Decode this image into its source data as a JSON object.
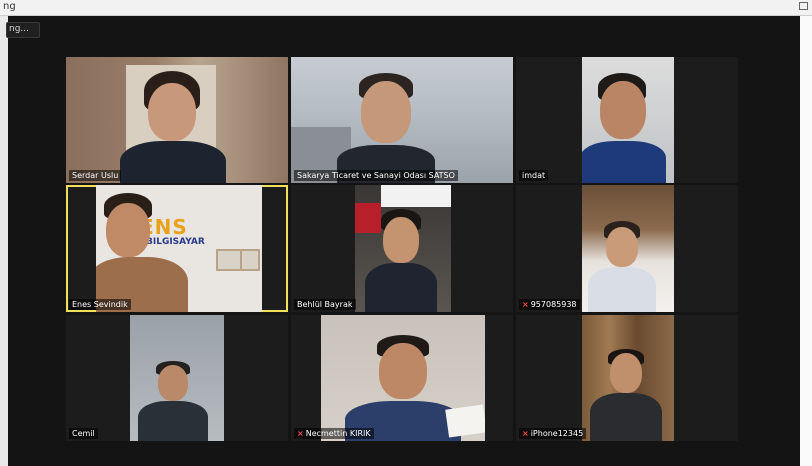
{
  "window": {
    "title": "ng",
    "status_pill": "ng..."
  },
  "participants": [
    {
      "name": "Serdar Uslu",
      "muted": false
    },
    {
      "name": "Sakarya Ticaret ve Sanayi Odası SATSO",
      "muted": false
    },
    {
      "name": "imdat",
      "muted": false
    },
    {
      "name": "Enes Sevindik",
      "muted": false,
      "active_speaker": true
    },
    {
      "name": "Behlül Bayrak",
      "muted": false
    },
    {
      "name": "957085938",
      "muted": true
    },
    {
      "name": "Cemil",
      "muted": false
    },
    {
      "name": "Necmettin KIRIK",
      "muted": true
    },
    {
      "name": "iPhone12345",
      "muted": true
    }
  ],
  "banner": {
    "line1": "ENS",
    "line2": "BILGISAYAR"
  },
  "colors": {
    "active_border": "#f3e05a",
    "mute_icon": "#ff4b4b",
    "meeting_bg": "#141414"
  },
  "icons": {
    "mute": "mic-off-icon"
  }
}
